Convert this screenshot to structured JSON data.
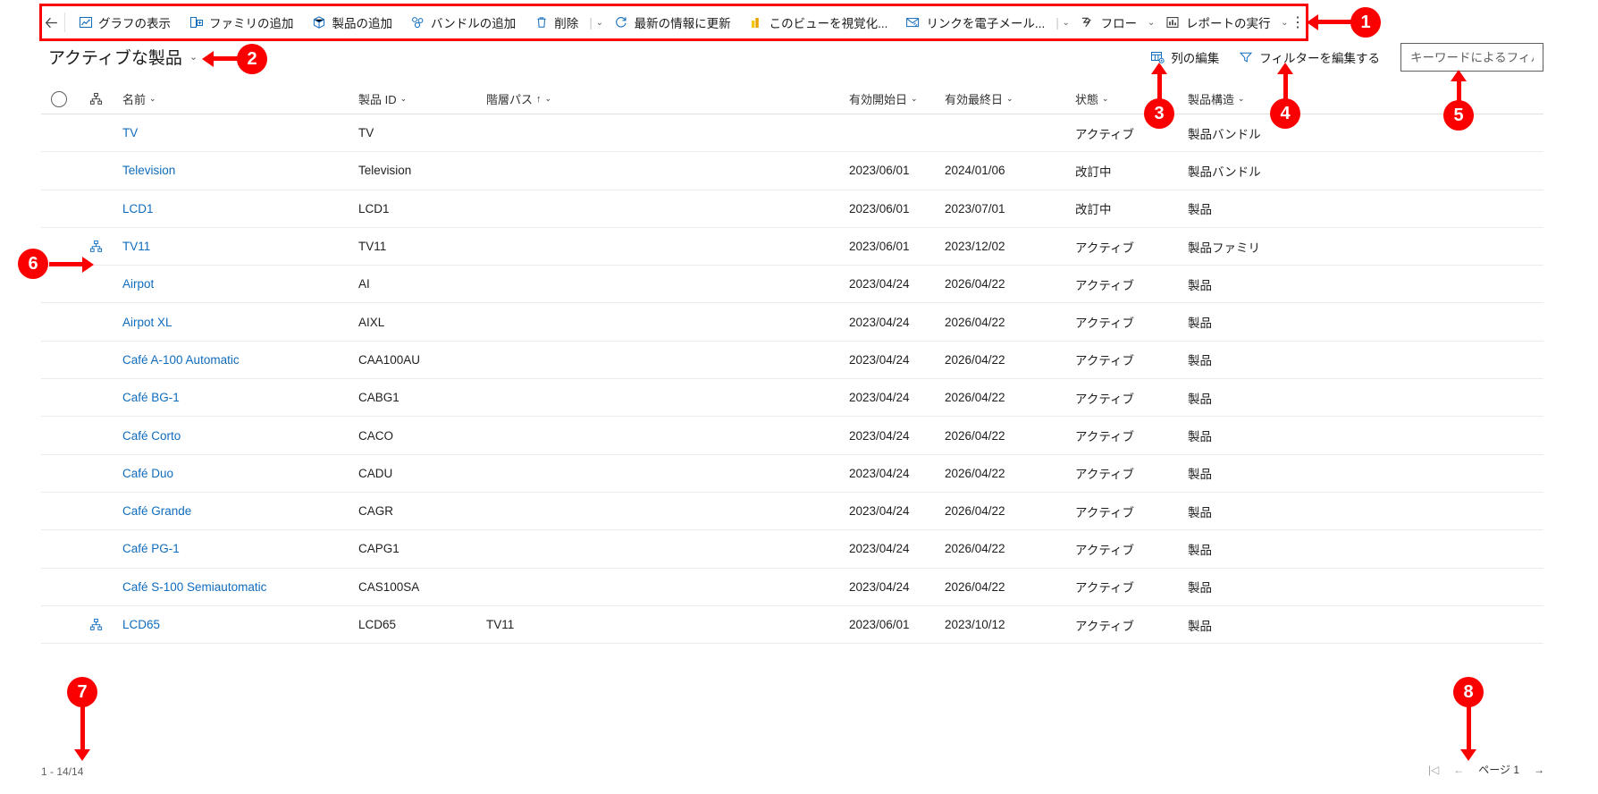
{
  "commandbar": {
    "back_icon": "arrow-left-icon",
    "items": [
      {
        "label": "グラフの表示",
        "icon": "chart-icon"
      },
      {
        "label": "ファミリの追加",
        "icon": "add-family-icon"
      },
      {
        "label": "製品の追加",
        "icon": "add-product-icon"
      },
      {
        "label": "バンドルの追加",
        "icon": "add-bundle-icon"
      },
      {
        "label": "削除",
        "icon": "trash-icon"
      }
    ],
    "items2": [
      {
        "label": "最新の情報に更新",
        "icon": "refresh-icon"
      },
      {
        "label": "このビューを視覚化...",
        "icon": "visualize-icon"
      },
      {
        "label": "リンクを電子メール...",
        "icon": "email-link-icon"
      }
    ],
    "items3": [
      {
        "label": "フロー",
        "icon": "flow-icon"
      },
      {
        "label": "レポートの実行",
        "icon": "report-icon"
      }
    ],
    "overflow_label": "⋮"
  },
  "view": {
    "title": "アクティブな製品",
    "caret": "⌄"
  },
  "header_actions": {
    "edit_columns": "列の編集",
    "edit_filters": "フィルターを編集する",
    "search_placeholder": "キーワードによるフィルタ",
    "search_value": ""
  },
  "grid": {
    "columns": [
      {
        "key": "name",
        "label": "名前",
        "sort": ""
      },
      {
        "key": "pid",
        "label": "製品 ID",
        "sort": ""
      },
      {
        "key": "path",
        "label": "階層パス",
        "sort": "↑"
      },
      {
        "key": "start",
        "label": "有効開始日",
        "sort": ""
      },
      {
        "key": "end",
        "label": "有効最終日",
        "sort": ""
      },
      {
        "key": "state",
        "label": "状態",
        "sort": ""
      },
      {
        "key": "struct",
        "label": "製品構造",
        "sort": ""
      }
    ],
    "rows": [
      {
        "hier": false,
        "name": "TV",
        "pid": "TV",
        "path": "",
        "start": "",
        "end": "",
        "state": "アクティブ",
        "struct": "製品バンドル"
      },
      {
        "hier": false,
        "name": "Television",
        "pid": "Television",
        "path": "",
        "start": "2023/06/01",
        "end": "2024/01/06",
        "state": "改訂中",
        "struct": "製品バンドル"
      },
      {
        "hier": false,
        "name": "LCD1",
        "pid": "LCD1",
        "path": "",
        "start": "2023/06/01",
        "end": "2023/07/01",
        "state": "改訂中",
        "struct": "製品"
      },
      {
        "hier": true,
        "name": "TV11",
        "pid": "TV11",
        "path": "",
        "start": "2023/06/01",
        "end": "2023/12/02",
        "state": "アクティブ",
        "struct": "製品ファミリ"
      },
      {
        "hier": false,
        "name": "Airpot",
        "pid": "AI",
        "path": "",
        "start": "2023/04/24",
        "end": "2026/04/22",
        "state": "アクティブ",
        "struct": "製品"
      },
      {
        "hier": false,
        "name": "Airpot XL",
        "pid": "AIXL",
        "path": "",
        "start": "2023/04/24",
        "end": "2026/04/22",
        "state": "アクティブ",
        "struct": "製品"
      },
      {
        "hier": false,
        "name": "Café A-100 Automatic",
        "pid": "CAA100AU",
        "path": "",
        "start": "2023/04/24",
        "end": "2026/04/22",
        "state": "アクティブ",
        "struct": "製品"
      },
      {
        "hier": false,
        "name": "Café BG-1",
        "pid": "CABG1",
        "path": "",
        "start": "2023/04/24",
        "end": "2026/04/22",
        "state": "アクティブ",
        "struct": "製品"
      },
      {
        "hier": false,
        "name": "Café Corto",
        "pid": "CACO",
        "path": "",
        "start": "2023/04/24",
        "end": "2026/04/22",
        "state": "アクティブ",
        "struct": "製品"
      },
      {
        "hier": false,
        "name": "Café Duo",
        "pid": "CADU",
        "path": "",
        "start": "2023/04/24",
        "end": "2026/04/22",
        "state": "アクティブ",
        "struct": "製品"
      },
      {
        "hier": false,
        "name": "Café Grande",
        "pid": "CAGR",
        "path": "",
        "start": "2023/04/24",
        "end": "2026/04/22",
        "state": "アクティブ",
        "struct": "製品"
      },
      {
        "hier": false,
        "name": "Café PG-1",
        "pid": "CAPG1",
        "path": "",
        "start": "2023/04/24",
        "end": "2026/04/22",
        "state": "アクティブ",
        "struct": "製品"
      },
      {
        "hier": false,
        "name": "Café S-100 Semiautomatic",
        "pid": "CAS100SA",
        "path": "",
        "start": "2023/04/24",
        "end": "2026/04/22",
        "state": "アクティブ",
        "struct": "製品"
      },
      {
        "hier": true,
        "name": "LCD65",
        "pid": "LCD65",
        "path": "TV11",
        "start": "2023/06/01",
        "end": "2023/10/12",
        "state": "アクティブ",
        "struct": "製品"
      }
    ]
  },
  "footer": {
    "row_count": "1 - 14/14",
    "first_icon": "|◁",
    "prev_icon": "←",
    "page_label": "ページ 1",
    "next_icon": "→"
  },
  "annotations": [
    {
      "id": "1",
      "label": "1"
    },
    {
      "id": "2",
      "label": "2"
    },
    {
      "id": "3",
      "label": "3"
    },
    {
      "id": "4",
      "label": "4"
    },
    {
      "id": "5",
      "label": "5"
    },
    {
      "id": "6",
      "label": "6"
    },
    {
      "id": "7",
      "label": "7"
    },
    {
      "id": "8",
      "label": "8"
    }
  ],
  "colors": {
    "accent": "#0f6cbd",
    "link": "#0f6cbd",
    "annotation": "#fb0000",
    "border": "#edebe9"
  }
}
